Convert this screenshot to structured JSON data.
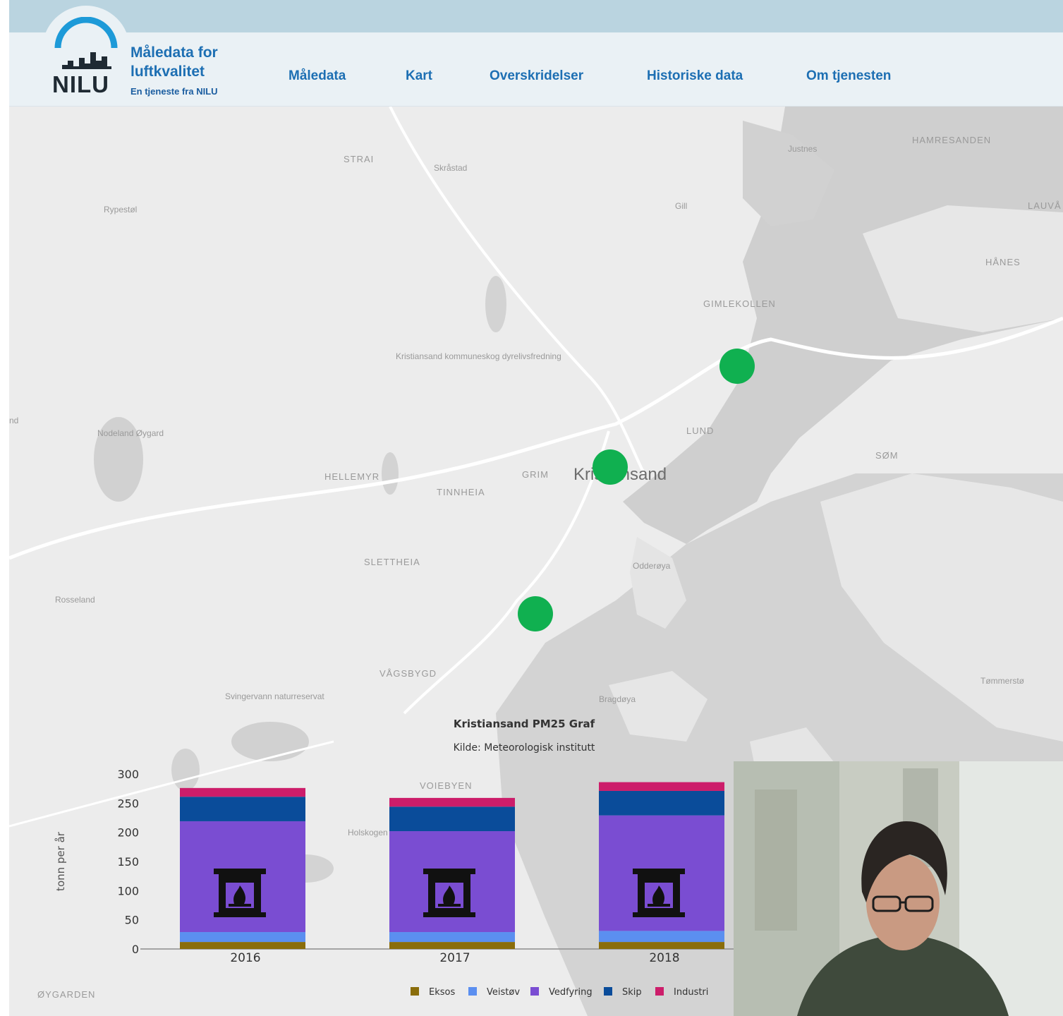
{
  "header": {
    "logo": {
      "abbr": "NILU",
      "title_line1": "Måledata for",
      "title_line2": "luftkvalitet",
      "subtitle": "En tjeneste fra NILU"
    },
    "nav": [
      {
        "label": "Måledata",
        "name": "nav-maledata"
      },
      {
        "label": "Kart",
        "name": "nav-kart"
      },
      {
        "label": "Overskridelser",
        "name": "nav-overskridelser"
      },
      {
        "label": "Historiske data",
        "name": "nav-historiske-data"
      },
      {
        "label": "Om tjenesten",
        "name": "nav-om-tjenesten"
      }
    ],
    "colors": {
      "topbar": "#bad4e0",
      "navbar": "#eaf1f5",
      "accent": "#1d6fb3"
    }
  },
  "map": {
    "labels": [
      "STRAI",
      "Skråstad",
      "Justnes",
      "HAMRESANDEN",
      "Rypestøl",
      "Gill",
      "LAUVÅ",
      "HÅNES",
      "GIMLEKOLLEN",
      "LUND",
      "Nodeland Øygard",
      "SØM",
      "HELLEMYR",
      "GRIM",
      "TINNHEIA",
      "Kristiansand",
      "SLETTHEIA",
      "Odderøya",
      "Rosseland",
      "VÅGSBYGD",
      "Tømmerstø",
      "Svingervann naturreservat",
      "Bragdøya",
      "VOIEBYEN",
      "Holskogen",
      "ØYGARDEN",
      "Kristiansand kommuneskog dyrelivsfredning",
      "nd"
    ],
    "station_color": "#10b050",
    "station_count": 3
  },
  "chart_data": {
    "type": "bar",
    "stacked": true,
    "title": "Kristiansand PM25 Graf",
    "subtitle": "Kilde: Meteorologisk institutt",
    "ylabel": "tonn per år",
    "xlabel": "",
    "ylim": [
      0,
      300
    ],
    "yticks": [
      0,
      50,
      100,
      150,
      200,
      250,
      300
    ],
    "categories": [
      "2016",
      "2017",
      "2018"
    ],
    "series": [
      {
        "name": "Eksos",
        "color": "#8a6d0b",
        "values": [
          12,
          12,
          12
        ]
      },
      {
        "name": "Veistøv",
        "color": "#5b8ff0",
        "values": [
          17,
          17,
          19
        ]
      },
      {
        "name": "Vedfyring",
        "color": "#7a4dd2",
        "values": [
          190,
          173,
          198
        ]
      },
      {
        "name": "Skip",
        "color": "#0a4c9a",
        "values": [
          42,
          42,
          42
        ]
      },
      {
        "name": "Industri",
        "color": "#cc1d6a",
        "values": [
          15,
          15,
          15
        ]
      }
    ],
    "legend_position": "bottom",
    "bar_icon": "fireplace-icon",
    "grid": false
  },
  "video": {
    "icon": "webcam-feed"
  }
}
